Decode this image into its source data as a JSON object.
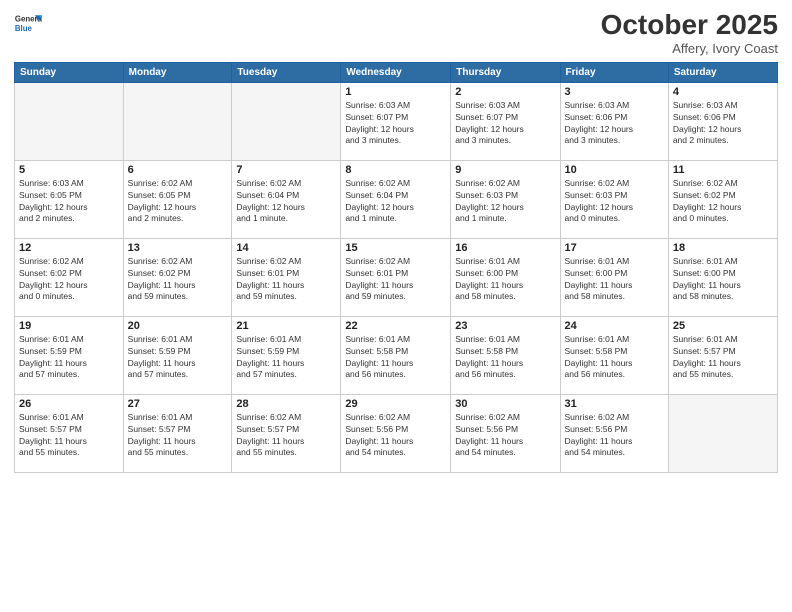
{
  "header": {
    "logo_general": "General",
    "logo_blue": "Blue",
    "month_title": "October 2025",
    "location": "Affery, Ivory Coast"
  },
  "weekdays": [
    "Sunday",
    "Monday",
    "Tuesday",
    "Wednesday",
    "Thursday",
    "Friday",
    "Saturday"
  ],
  "weeks": [
    [
      {
        "day": "",
        "info": ""
      },
      {
        "day": "",
        "info": ""
      },
      {
        "day": "",
        "info": ""
      },
      {
        "day": "1",
        "info": "Sunrise: 6:03 AM\nSunset: 6:07 PM\nDaylight: 12 hours\nand 3 minutes."
      },
      {
        "day": "2",
        "info": "Sunrise: 6:03 AM\nSunset: 6:07 PM\nDaylight: 12 hours\nand 3 minutes."
      },
      {
        "day": "3",
        "info": "Sunrise: 6:03 AM\nSunset: 6:06 PM\nDaylight: 12 hours\nand 3 minutes."
      },
      {
        "day": "4",
        "info": "Sunrise: 6:03 AM\nSunset: 6:06 PM\nDaylight: 12 hours\nand 2 minutes."
      }
    ],
    [
      {
        "day": "5",
        "info": "Sunrise: 6:03 AM\nSunset: 6:05 PM\nDaylight: 12 hours\nand 2 minutes."
      },
      {
        "day": "6",
        "info": "Sunrise: 6:02 AM\nSunset: 6:05 PM\nDaylight: 12 hours\nand 2 minutes."
      },
      {
        "day": "7",
        "info": "Sunrise: 6:02 AM\nSunset: 6:04 PM\nDaylight: 12 hours\nand 1 minute."
      },
      {
        "day": "8",
        "info": "Sunrise: 6:02 AM\nSunset: 6:04 PM\nDaylight: 12 hours\nand 1 minute."
      },
      {
        "day": "9",
        "info": "Sunrise: 6:02 AM\nSunset: 6:03 PM\nDaylight: 12 hours\nand 1 minute."
      },
      {
        "day": "10",
        "info": "Sunrise: 6:02 AM\nSunset: 6:03 PM\nDaylight: 12 hours\nand 0 minutes."
      },
      {
        "day": "11",
        "info": "Sunrise: 6:02 AM\nSunset: 6:02 PM\nDaylight: 12 hours\nand 0 minutes."
      }
    ],
    [
      {
        "day": "12",
        "info": "Sunrise: 6:02 AM\nSunset: 6:02 PM\nDaylight: 12 hours\nand 0 minutes."
      },
      {
        "day": "13",
        "info": "Sunrise: 6:02 AM\nSunset: 6:02 PM\nDaylight: 11 hours\nand 59 minutes."
      },
      {
        "day": "14",
        "info": "Sunrise: 6:02 AM\nSunset: 6:01 PM\nDaylight: 11 hours\nand 59 minutes."
      },
      {
        "day": "15",
        "info": "Sunrise: 6:02 AM\nSunset: 6:01 PM\nDaylight: 11 hours\nand 59 minutes."
      },
      {
        "day": "16",
        "info": "Sunrise: 6:01 AM\nSunset: 6:00 PM\nDaylight: 11 hours\nand 58 minutes."
      },
      {
        "day": "17",
        "info": "Sunrise: 6:01 AM\nSunset: 6:00 PM\nDaylight: 11 hours\nand 58 minutes."
      },
      {
        "day": "18",
        "info": "Sunrise: 6:01 AM\nSunset: 6:00 PM\nDaylight: 11 hours\nand 58 minutes."
      }
    ],
    [
      {
        "day": "19",
        "info": "Sunrise: 6:01 AM\nSunset: 5:59 PM\nDaylight: 11 hours\nand 57 minutes."
      },
      {
        "day": "20",
        "info": "Sunrise: 6:01 AM\nSunset: 5:59 PM\nDaylight: 11 hours\nand 57 minutes."
      },
      {
        "day": "21",
        "info": "Sunrise: 6:01 AM\nSunset: 5:59 PM\nDaylight: 11 hours\nand 57 minutes."
      },
      {
        "day": "22",
        "info": "Sunrise: 6:01 AM\nSunset: 5:58 PM\nDaylight: 11 hours\nand 56 minutes."
      },
      {
        "day": "23",
        "info": "Sunrise: 6:01 AM\nSunset: 5:58 PM\nDaylight: 11 hours\nand 56 minutes."
      },
      {
        "day": "24",
        "info": "Sunrise: 6:01 AM\nSunset: 5:58 PM\nDaylight: 11 hours\nand 56 minutes."
      },
      {
        "day": "25",
        "info": "Sunrise: 6:01 AM\nSunset: 5:57 PM\nDaylight: 11 hours\nand 55 minutes."
      }
    ],
    [
      {
        "day": "26",
        "info": "Sunrise: 6:01 AM\nSunset: 5:57 PM\nDaylight: 11 hours\nand 55 minutes."
      },
      {
        "day": "27",
        "info": "Sunrise: 6:01 AM\nSunset: 5:57 PM\nDaylight: 11 hours\nand 55 minutes."
      },
      {
        "day": "28",
        "info": "Sunrise: 6:02 AM\nSunset: 5:57 PM\nDaylight: 11 hours\nand 55 minutes."
      },
      {
        "day": "29",
        "info": "Sunrise: 6:02 AM\nSunset: 5:56 PM\nDaylight: 11 hours\nand 54 minutes."
      },
      {
        "day": "30",
        "info": "Sunrise: 6:02 AM\nSunset: 5:56 PM\nDaylight: 11 hours\nand 54 minutes."
      },
      {
        "day": "31",
        "info": "Sunrise: 6:02 AM\nSunset: 5:56 PM\nDaylight: 11 hours\nand 54 minutes."
      },
      {
        "day": "",
        "info": ""
      }
    ]
  ]
}
